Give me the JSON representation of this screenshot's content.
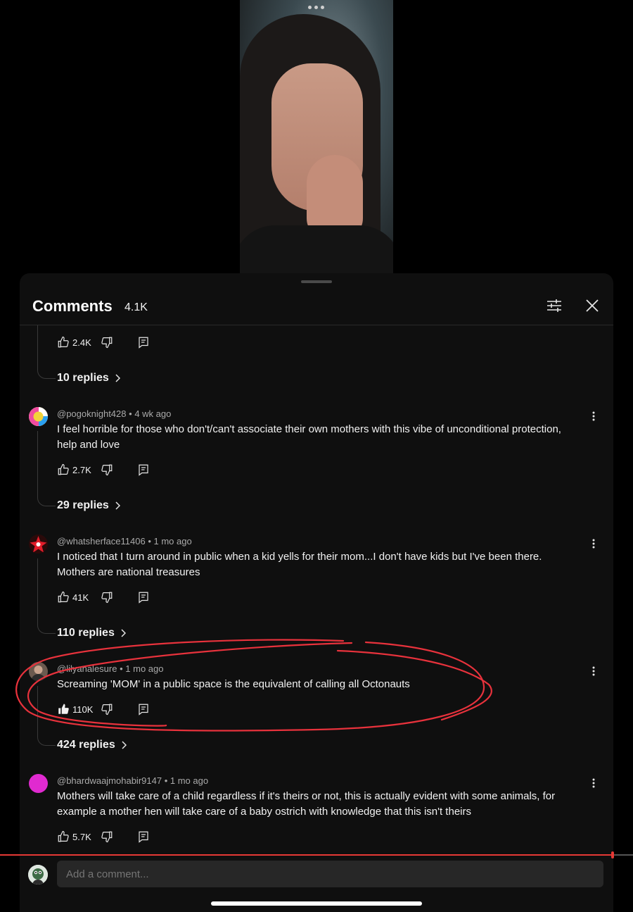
{
  "header": {
    "title": "Comments",
    "count": "4.1K"
  },
  "composer": {
    "placeholder": "Add a comment..."
  },
  "top_partial": {
    "likes": "2.4K",
    "replies": "10 replies"
  },
  "comments": [
    {
      "handle": "@pogoknight428",
      "age": "4 wk ago",
      "text": "I feel horrible for those who don't/can't associate their own mothers with this vibe of unconditional protection, help and love",
      "likes": "2.7K",
      "replies": "29 replies",
      "avatar_color": "#f2c230"
    },
    {
      "handle": "@whatsherface11406",
      "age": "1 mo ago",
      "text": "I noticed that I turn around in public when a kid yells for their mom...I don't have kids but I've been there. Mothers are national treasures",
      "likes": "41K",
      "replies": "110 replies",
      "avatar_color": "#d11d2a"
    },
    {
      "handle": "@lilyanalesure",
      "age": "1 mo ago",
      "text": "Screaming 'MOM' in a public space is the equivalent of calling all Octonauts",
      "likes": "110K",
      "replies": "424 replies",
      "avatar_color": "#8a6a5a"
    },
    {
      "handle": "@bhardwaajmohabir9147",
      "age": "1 mo ago",
      "text": "Mothers will take care of a child regardless if it's theirs or not, this is actually evident with some animals, for example a mother hen will take care of a baby ostrich with knowledge that this isn't theirs",
      "likes": "5.7K",
      "replies": "",
      "avatar_color": "#e02ad0"
    }
  ],
  "colors": {
    "sheet_bg": "#0f0f0f",
    "annotation": "#e8323c",
    "progress": "#e53935"
  },
  "icons": {
    "like": "thumbs-up-icon",
    "dislike": "thumbs-down-icon",
    "reply": "comment-icon",
    "filter": "sliders-icon",
    "close": "close-icon",
    "more": "more-vert-icon"
  },
  "separator": "•"
}
